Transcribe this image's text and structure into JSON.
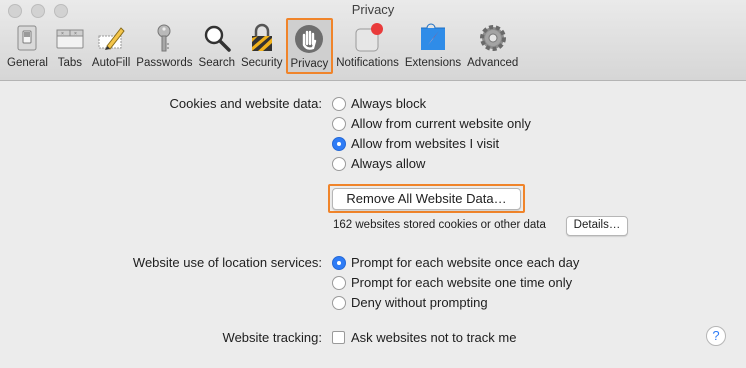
{
  "window": {
    "title": "Privacy"
  },
  "toolbar": {
    "items": [
      {
        "label": "General",
        "icon": "general-switch-icon"
      },
      {
        "label": "Tabs",
        "icon": "tabs-icon"
      },
      {
        "label": "AutoFill",
        "icon": "autofill-pencil-icon"
      },
      {
        "label": "Passwords",
        "icon": "key-icon"
      },
      {
        "label": "Search",
        "icon": "magnifier-icon"
      },
      {
        "label": "Security",
        "icon": "security-padlock-icon"
      },
      {
        "label": "Privacy",
        "icon": "privacy-hand-icon",
        "selected": true
      },
      {
        "label": "Notifications",
        "icon": "notifications-badge-icon"
      },
      {
        "label": "Extensions",
        "icon": "extensions-compass-icon"
      },
      {
        "label": "Advanced",
        "icon": "advanced-gear-icon"
      }
    ]
  },
  "cookies": {
    "label": "Cookies and website data:",
    "options": [
      {
        "label": "Always block",
        "selected": false
      },
      {
        "label": "Allow from current website only",
        "selected": false
      },
      {
        "label": "Allow from websites I visit",
        "selected": true
      },
      {
        "label": "Always allow",
        "selected": false
      }
    ],
    "remove_button": "Remove All Website Data…",
    "stored_text": "162 websites stored cookies or other data",
    "details_button": "Details…"
  },
  "location": {
    "label": "Website use of location services:",
    "options": [
      {
        "label": "Prompt for each website once each day",
        "selected": true
      },
      {
        "label": "Prompt for each website one time only",
        "selected": false
      },
      {
        "label": "Deny without prompting",
        "selected": false
      }
    ]
  },
  "tracking": {
    "label": "Website tracking:",
    "checkbox_label": "Ask websites not to track me",
    "checked": false
  },
  "help": {
    "glyph": "?"
  },
  "colors": {
    "accent": "#2e7cf6",
    "highlight": "#f0842a"
  }
}
